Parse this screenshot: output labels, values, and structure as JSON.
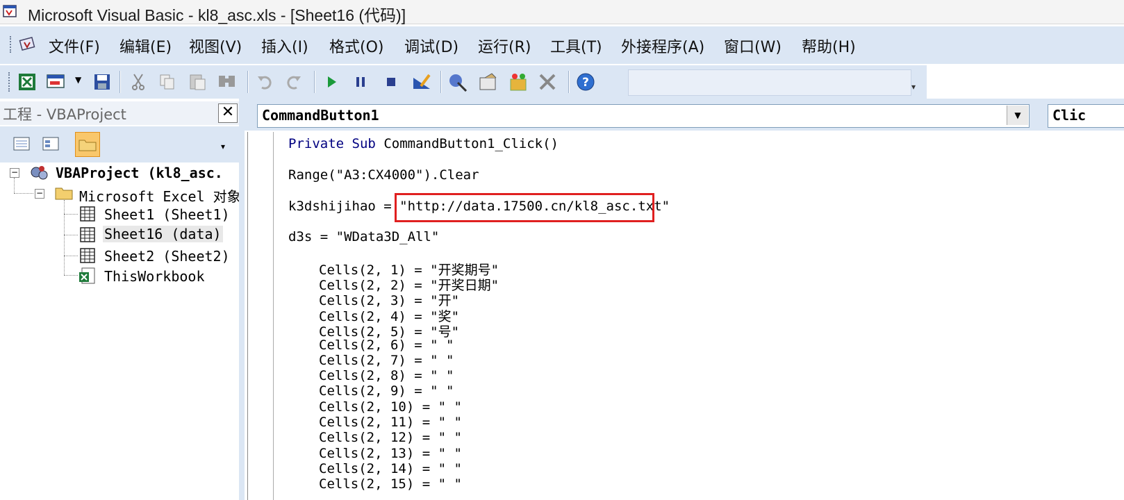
{
  "window": {
    "title": "Microsoft Visual Basic - kl8_asc.xls - [Sheet16 (代码)]"
  },
  "menu": {
    "items": [
      "文件(F)",
      "编辑(E)",
      "视图(V)",
      "插入(I)",
      "格式(O)",
      "调试(D)",
      "运行(R)",
      "工具(T)",
      "外接程序(A)",
      "窗口(W)",
      "帮助(H)"
    ]
  },
  "toolbar": {
    "icons": [
      "view-excel-icon",
      "insert-userform-icon",
      "save-icon",
      "cut-icon",
      "copy-icon",
      "paste-icon",
      "find-icon",
      "undo-icon",
      "redo-icon",
      "run-icon",
      "break-icon",
      "reset-icon",
      "design-mode-icon",
      "project-explorer-icon",
      "properties-icon",
      "object-browser-icon",
      "toolbox-icon",
      "help-icon"
    ]
  },
  "project": {
    "title": "工程 - VBAProject",
    "close_label": "✕",
    "tree": {
      "root": "VBAProject (kl8_asc.",
      "folder": "Microsoft Excel 对象",
      "items": [
        "Sheet1 (Sheet1)",
        "Sheet16 (data)",
        "Sheet2 (Sheet2)",
        "ThisWorkbook"
      ]
    }
  },
  "code": {
    "object_combo": "CommandButton1",
    "proc_combo": "Clic",
    "lines": {
      "sub_kw1": "Private",
      "sub_kw2": "Sub",
      "sub_name": "CommandButton1_Click()",
      "range": "Range(\"A3:CX4000\").Clear",
      "k3d": "k3dshijihao = \"http://data.17500.cn/kl8_asc.txt\"",
      "d3s": "d3s = \"WData3D_All\"",
      "cells": [
        "Cells(2, 1) = \"开奖期号\"",
        "Cells(2, 2) = \"开奖日期\"",
        "Cells(2, 3) = \"开\"",
        "Cells(2, 4) = \"奖\"",
        "Cells(2, 5) = \"号\"",
        "Cells(2, 6) = \" \"",
        "Cells(2, 7) = \" \"",
        "Cells(2, 8) = \" \"",
        "Cells(2, 9) = \" \"",
        "Cells(2, 10) = \" \"",
        "Cells(2, 11) = \" \"",
        "Cells(2, 12) = \" \"",
        "Cells(2, 13) = \" \"",
        "Cells(2, 14) = \" \"",
        "Cells(2, 15) = \" \""
      ]
    }
  },
  "colors": {
    "keyword": "#000080",
    "highlight": "#e02020",
    "chrome": "#dbe6f4"
  }
}
